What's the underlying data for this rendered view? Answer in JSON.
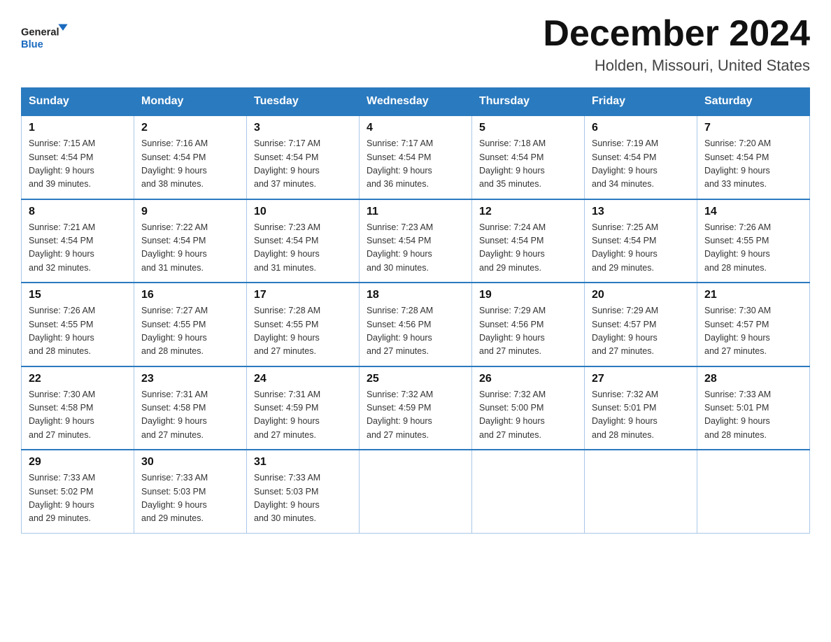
{
  "header": {
    "logo_text_general": "General",
    "logo_text_blue": "Blue",
    "month_title": "December 2024",
    "location": "Holden, Missouri, United States"
  },
  "days_of_week": [
    "Sunday",
    "Monday",
    "Tuesday",
    "Wednesday",
    "Thursday",
    "Friday",
    "Saturday"
  ],
  "weeks": [
    [
      {
        "day": "1",
        "sunrise": "7:15 AM",
        "sunset": "4:54 PM",
        "daylight": "9 hours and 39 minutes."
      },
      {
        "day": "2",
        "sunrise": "7:16 AM",
        "sunset": "4:54 PM",
        "daylight": "9 hours and 38 minutes."
      },
      {
        "day": "3",
        "sunrise": "7:17 AM",
        "sunset": "4:54 PM",
        "daylight": "9 hours and 37 minutes."
      },
      {
        "day": "4",
        "sunrise": "7:17 AM",
        "sunset": "4:54 PM",
        "daylight": "9 hours and 36 minutes."
      },
      {
        "day": "5",
        "sunrise": "7:18 AM",
        "sunset": "4:54 PM",
        "daylight": "9 hours and 35 minutes."
      },
      {
        "day": "6",
        "sunrise": "7:19 AM",
        "sunset": "4:54 PM",
        "daylight": "9 hours and 34 minutes."
      },
      {
        "day": "7",
        "sunrise": "7:20 AM",
        "sunset": "4:54 PM",
        "daylight": "9 hours and 33 minutes."
      }
    ],
    [
      {
        "day": "8",
        "sunrise": "7:21 AM",
        "sunset": "4:54 PM",
        "daylight": "9 hours and 32 minutes."
      },
      {
        "day": "9",
        "sunrise": "7:22 AM",
        "sunset": "4:54 PM",
        "daylight": "9 hours and 31 minutes."
      },
      {
        "day": "10",
        "sunrise": "7:23 AM",
        "sunset": "4:54 PM",
        "daylight": "9 hours and 31 minutes."
      },
      {
        "day": "11",
        "sunrise": "7:23 AM",
        "sunset": "4:54 PM",
        "daylight": "9 hours and 30 minutes."
      },
      {
        "day": "12",
        "sunrise": "7:24 AM",
        "sunset": "4:54 PM",
        "daylight": "9 hours and 29 minutes."
      },
      {
        "day": "13",
        "sunrise": "7:25 AM",
        "sunset": "4:54 PM",
        "daylight": "9 hours and 29 minutes."
      },
      {
        "day": "14",
        "sunrise": "7:26 AM",
        "sunset": "4:55 PM",
        "daylight": "9 hours and 28 minutes."
      }
    ],
    [
      {
        "day": "15",
        "sunrise": "7:26 AM",
        "sunset": "4:55 PM",
        "daylight": "9 hours and 28 minutes."
      },
      {
        "day": "16",
        "sunrise": "7:27 AM",
        "sunset": "4:55 PM",
        "daylight": "9 hours and 28 minutes."
      },
      {
        "day": "17",
        "sunrise": "7:28 AM",
        "sunset": "4:55 PM",
        "daylight": "9 hours and 27 minutes."
      },
      {
        "day": "18",
        "sunrise": "7:28 AM",
        "sunset": "4:56 PM",
        "daylight": "9 hours and 27 minutes."
      },
      {
        "day": "19",
        "sunrise": "7:29 AM",
        "sunset": "4:56 PM",
        "daylight": "9 hours and 27 minutes."
      },
      {
        "day": "20",
        "sunrise": "7:29 AM",
        "sunset": "4:57 PM",
        "daylight": "9 hours and 27 minutes."
      },
      {
        "day": "21",
        "sunrise": "7:30 AM",
        "sunset": "4:57 PM",
        "daylight": "9 hours and 27 minutes."
      }
    ],
    [
      {
        "day": "22",
        "sunrise": "7:30 AM",
        "sunset": "4:58 PM",
        "daylight": "9 hours and 27 minutes."
      },
      {
        "day": "23",
        "sunrise": "7:31 AM",
        "sunset": "4:58 PM",
        "daylight": "9 hours and 27 minutes."
      },
      {
        "day": "24",
        "sunrise": "7:31 AM",
        "sunset": "4:59 PM",
        "daylight": "9 hours and 27 minutes."
      },
      {
        "day": "25",
        "sunrise": "7:32 AM",
        "sunset": "4:59 PM",
        "daylight": "9 hours and 27 minutes."
      },
      {
        "day": "26",
        "sunrise": "7:32 AM",
        "sunset": "5:00 PM",
        "daylight": "9 hours and 27 minutes."
      },
      {
        "day": "27",
        "sunrise": "7:32 AM",
        "sunset": "5:01 PM",
        "daylight": "9 hours and 28 minutes."
      },
      {
        "day": "28",
        "sunrise": "7:33 AM",
        "sunset": "5:01 PM",
        "daylight": "9 hours and 28 minutes."
      }
    ],
    [
      {
        "day": "29",
        "sunrise": "7:33 AM",
        "sunset": "5:02 PM",
        "daylight": "9 hours and 29 minutes."
      },
      {
        "day": "30",
        "sunrise": "7:33 AM",
        "sunset": "5:03 PM",
        "daylight": "9 hours and 29 minutes."
      },
      {
        "day": "31",
        "sunrise": "7:33 AM",
        "sunset": "5:03 PM",
        "daylight": "9 hours and 30 minutes."
      },
      null,
      null,
      null,
      null
    ]
  ],
  "labels": {
    "sunrise": "Sunrise:",
    "sunset": "Sunset:",
    "daylight": "Daylight:"
  }
}
